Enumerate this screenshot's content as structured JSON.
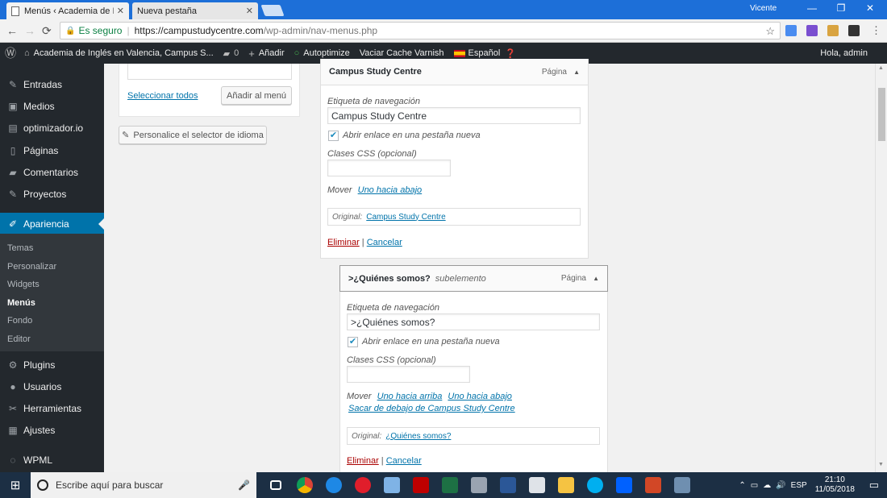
{
  "browser": {
    "tabs": [
      {
        "title": "Menús ‹ Academia de Ing",
        "active": true
      },
      {
        "title": "Nueva pestaña",
        "active": false
      }
    ],
    "user": "Vicente",
    "window_controls": {
      "minimize": "—",
      "restore": "❐",
      "close": "✕"
    },
    "secure_label": "Es seguro",
    "url_host": "https://campustudycentre.com",
    "url_path": "/wp-admin/nav-menus.php",
    "nav": {
      "back": "←",
      "forward": "→",
      "reload": "⟳"
    },
    "star": "☆",
    "menu": "⋮"
  },
  "adminbar": {
    "site_name": "Academia de Inglés en Valencia, Campus S...",
    "comments_count": "0",
    "add_new": "Añadir",
    "autoptimize": "Autoptimize",
    "varnish": "Vaciar Cache Varnish",
    "language": "Español",
    "greeting": "Hola, admin"
  },
  "sidebar": {
    "items": [
      {
        "label": "Entradas",
        "icon": "pin-icon",
        "glyph": "✎"
      },
      {
        "label": "Medios",
        "icon": "media-icon",
        "glyph": "▣"
      },
      {
        "label": "optimizador.io",
        "icon": "image-icon",
        "glyph": "▤"
      },
      {
        "label": "Páginas",
        "icon": "page-icon",
        "glyph": "▯"
      },
      {
        "label": "Comentarios",
        "icon": "comment-icon",
        "glyph": "▰"
      },
      {
        "label": "Proyectos",
        "icon": "pin-icon",
        "glyph": "✎"
      },
      {
        "label": "Apariencia",
        "icon": "brush-icon",
        "glyph": "✐"
      },
      {
        "label": "Plugins",
        "icon": "plugin-icon",
        "glyph": "⚙"
      },
      {
        "label": "Usuarios",
        "icon": "user-icon",
        "glyph": "●"
      },
      {
        "label": "Herramientas",
        "icon": "wrench-icon",
        "glyph": "✂"
      },
      {
        "label": "Ajustes",
        "icon": "settings-icon",
        "glyph": "▦"
      },
      {
        "label": "WPML",
        "icon": "wpml-icon",
        "glyph": "◌"
      }
    ],
    "submenu": [
      "Temas",
      "Personalizar",
      "Widgets",
      "Menús",
      "Fondo",
      "Editor"
    ]
  },
  "left": {
    "select_all": "Seleccionar todos",
    "add_to_menu": "Añadir al menú",
    "customize_language": "Personalice el selector de idioma"
  },
  "menu_items": [
    {
      "title": "Campus Study Centre",
      "subtitle": "",
      "type": "Página",
      "nav_label_title": "Etiqueta de navegación",
      "nav_label_value": "Campus Study Centre",
      "new_tab_label": "Abrir enlace en una pestaña nueva",
      "css_label": "Clases CSS (opcional)",
      "css_value": "",
      "move_label": "Mover",
      "move_links": [
        "Uno hacia abajo"
      ],
      "original_label": "Original:",
      "original_link": "Campus Study Centre",
      "delete": "Eliminar",
      "cancel": "Cancelar"
    },
    {
      "title": ">¿Quiénes somos?",
      "subtitle": "subelemento",
      "type": "Página",
      "nav_label_title": "Etiqueta de navegación",
      "nav_label_value": ">¿Quiénes somos?",
      "new_tab_label": "Abrir enlace en una pestaña nueva",
      "css_label": "Clases CSS (opcional)",
      "css_value": "",
      "move_label": "Mover",
      "move_links": [
        "Uno hacia arriba",
        "Uno hacia abajo"
      ],
      "move_out": "Sacar de debajo de Campus Study Centre",
      "original_label": "Original:",
      "original_link": "¿Quiénes somos?",
      "delete": "Eliminar",
      "cancel": "Cancelar"
    }
  ],
  "taskbar": {
    "search_placeholder": "Escribe aquí para buscar",
    "language": "ESP",
    "time": "21:10",
    "date": "11/05/2018"
  },
  "colors": {
    "accent": "#0073aa",
    "adminbar": "#23282d",
    "delete": "#a00"
  }
}
